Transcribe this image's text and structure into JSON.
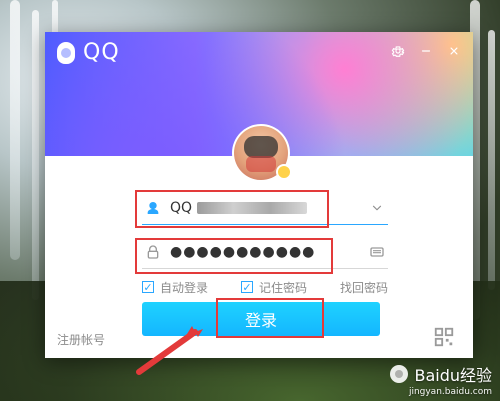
{
  "window": {
    "app_name": "QQ",
    "controls": {
      "settings_icon": "gear-icon",
      "minimize_icon": "minimize-icon",
      "close_icon": "close-icon"
    }
  },
  "login": {
    "account_value": "QQ",
    "password_mask": "●●●●●●●●●●●",
    "auto_login_label": "自动登录",
    "remember_password_label": "记住密码",
    "find_password_label": "找回密码",
    "login_button_label": "登录",
    "register_label": "注册帐号"
  },
  "watermark": {
    "brand": "Baidu经验",
    "url": "jingyan.baidu.com"
  },
  "colors": {
    "accent": "#14B6FF",
    "highlight_red": "#E33A3A"
  }
}
